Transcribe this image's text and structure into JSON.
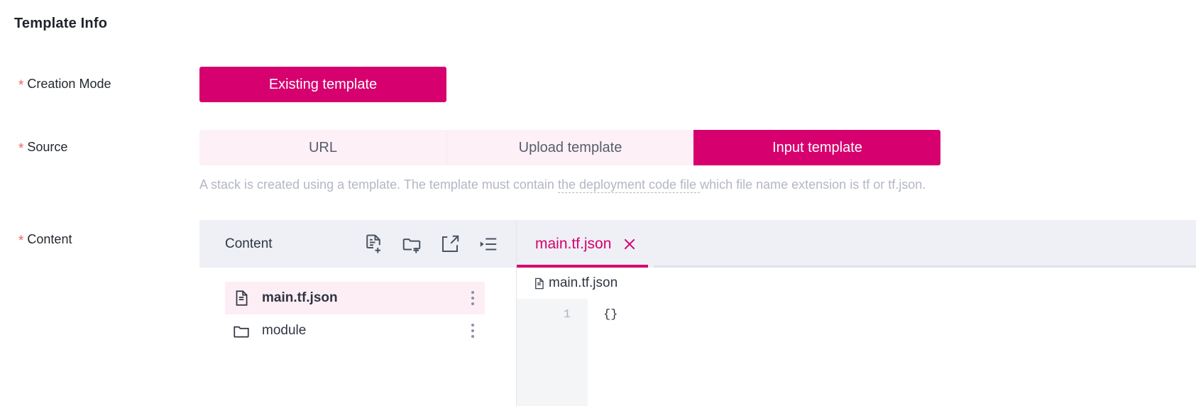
{
  "section": {
    "title": "Template Info"
  },
  "fields": {
    "creation_mode": {
      "label": "Creation Mode",
      "required_mark": "*",
      "selected": "Existing template"
    },
    "source": {
      "label": "Source",
      "required_mark": "*",
      "options": [
        "URL",
        "Upload template",
        "Input template"
      ],
      "selected_index": 2
    },
    "content": {
      "label": "Content",
      "required_mark": "*"
    }
  },
  "helper": {
    "before": "A stack is created using a template. The template must contain ",
    "tooltip_term": "the deployment code file ",
    "after": "which file name extension is tf or tf.json."
  },
  "file_pane": {
    "title": "Content",
    "toolbar_icons": [
      "new-file-icon",
      "new-folder-icon",
      "upload-file-icon",
      "collapse-all-icon"
    ],
    "items": [
      {
        "name": "main.tf.json",
        "type": "file",
        "selected": true,
        "menu_icon": "more-vertical-icon"
      },
      {
        "name": "module",
        "type": "folder",
        "selected": false,
        "menu_icon": "more-vertical-icon"
      }
    ]
  },
  "code_pane": {
    "tabs": [
      {
        "label": "main.tf.json",
        "active": true,
        "close_icon": "close-icon"
      }
    ],
    "breadcrumb": {
      "icon": "file-icon",
      "text": "main.tf.json"
    },
    "line_numbers": [
      "1"
    ],
    "lines": [
      "{}"
    ]
  },
  "colors": {
    "accent": "#d6006e",
    "accent_soft": "#fdf0f6",
    "required": "#f55f5f",
    "toolbar_bg": "#eef0f5",
    "helper_text": "#b3b7c4"
  }
}
